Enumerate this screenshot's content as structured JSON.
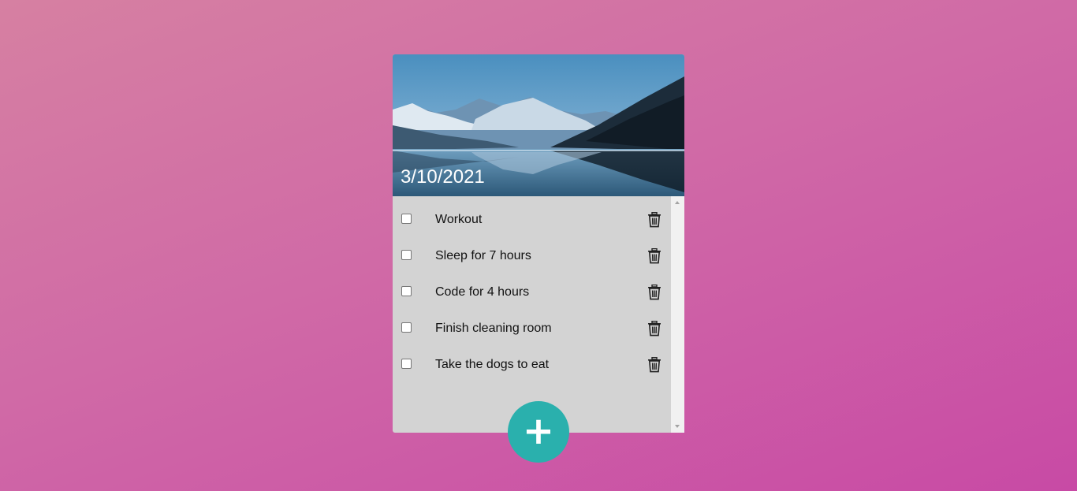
{
  "date": "3/10/2021",
  "todos": [
    {
      "label": "Workout",
      "checked": false
    },
    {
      "label": "Sleep for 7 hours",
      "checked": false
    },
    {
      "label": "Code for 4 hours",
      "checked": false
    },
    {
      "label": "Finish cleaning room",
      "checked": false
    },
    {
      "label": "Take the dogs to eat",
      "checked": false
    }
  ],
  "icons": {
    "delete": "trash-icon",
    "add": "plus-icon"
  },
  "fab_label": "+",
  "colors": {
    "accent": "#2ab0ad",
    "card": "#d3d3d3",
    "background_start": "#d680a2",
    "background_end": "#c84aa5"
  }
}
